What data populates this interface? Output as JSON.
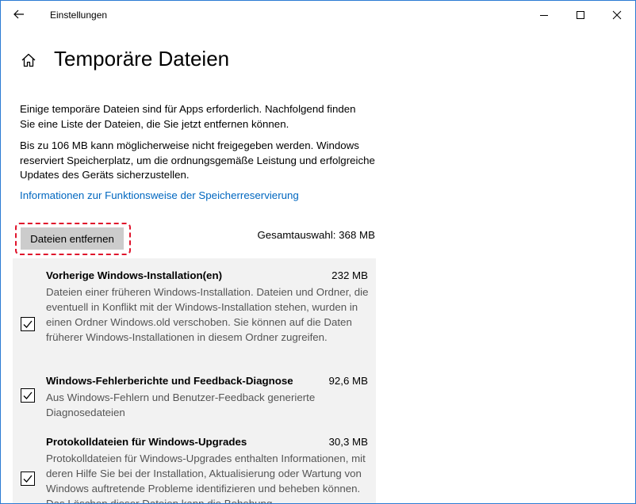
{
  "window": {
    "title": "Einstellungen"
  },
  "page": {
    "title": "Temporäre Dateien",
    "intro": "Einige temporäre Dateien sind für Apps erforderlich. Nachfolgend finden Sie eine Liste der Dateien, die Sie jetzt entfernen können.",
    "reserve_note": "Bis zu 106 MB kann möglicherweise nicht freigegeben werden. Windows reserviert Speicherplatz, um die ordnungsgemäße Leistung und erfolgreiche Updates des Geräts sicherzustellen.",
    "link": "Informationen zur Funktionsweise der Speicherreservierung",
    "remove_button": "Dateien entfernen",
    "total_selection": "Gesamtauswahl: 368 MB"
  },
  "items": [
    {
      "title": "Vorherige Windows-Installation(en)",
      "size": "232 MB",
      "description": "Dateien einer früheren Windows-Installation. Dateien und Ordner, die eventuell in Konflikt mit der Windows-Installation stehen, wurden in einen Ordner Windows.old verschoben. Sie können auf die Daten früherer Windows-Installationen in diesem Ordner zugreifen.",
      "checked": true
    },
    {
      "title": "Windows-Fehlerberichte und Feedback-Diagnose",
      "size": "92,6 MB",
      "description": "Aus Windows-Fehlern und Benutzer-Feedback generierte Diagnosedateien",
      "checked": true
    },
    {
      "title": "Protokolldateien für Windows-Upgrades",
      "size": "30,3 MB",
      "description": "Protokolldateien für Windows-Upgrades enthalten Informationen, mit deren Hilfe Sie bei der Installation, Aktualisierung oder Wartung von Windows auftretende Probleme identifizieren und beheben können. Das Löschen dieser Dateien kann die Behebung",
      "checked": true
    }
  ],
  "colors": {
    "link": "#0067c0",
    "highlight_border": "#e0142c",
    "list_bg": "#f2f2f2",
    "window_border": "#2b7bd4"
  }
}
